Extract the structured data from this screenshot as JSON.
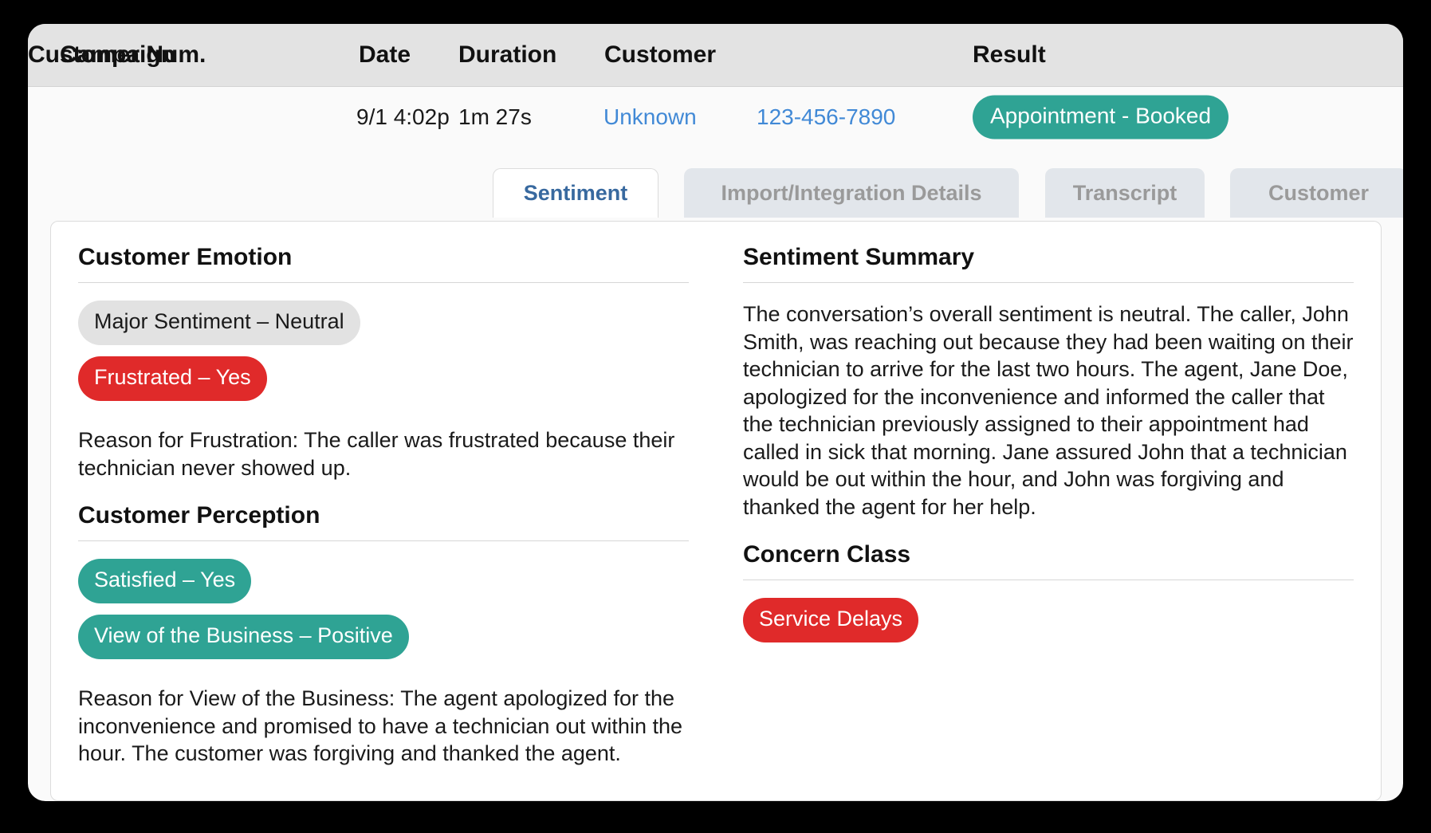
{
  "table": {
    "columns": [
      "Campaign",
      "Date",
      "Duration",
      "Customer",
      "Customer Num.",
      "Result"
    ],
    "row": {
      "campaign": "",
      "date": "9/1 4:02p",
      "duration": "1m 27s",
      "customer": "Unknown",
      "customer_number": "123-456-7890",
      "result": "Appointment - Booked"
    }
  },
  "tabs": [
    {
      "label": "Sentiment",
      "active": true
    },
    {
      "label": "Import/Integration Details",
      "active": false
    },
    {
      "label": "Transcript",
      "active": false
    },
    {
      "label": "Customer",
      "active": false
    }
  ],
  "sentiment": {
    "customer_emotion": {
      "heading": "Customer Emotion",
      "major_sentiment_badge": "Major Sentiment – Neutral",
      "frustrated_badge": "Frustrated – Yes",
      "reason": "Reason for Frustration: The caller was frustrated because their technician never showed up."
    },
    "customer_perception": {
      "heading": "Customer Perception",
      "satisfied_badge": "Satisfied – Yes",
      "view_badge": "View of the Business – Positive",
      "reason": "Reason for View of the Business: The agent apologized for the inconvenience and promised to have a technician out within the hour. The customer was forgiving and thanked the agent."
    },
    "summary": {
      "heading": "Sentiment Summary",
      "text": "The conversation’s overall sentiment is neutral. The caller, John Smith, was reaching out because they had been waiting on their technician to arrive for the last two hours. The agent, Jane Doe, apologized for the inconvenience and informed the caller that the technician previously assigned to their appointment had called in sick that morning. Jane assured John that a technician would be out within the hour, and John was forgiving and thanked the agent for her help."
    },
    "concern_class": {
      "heading": "Concern Class",
      "badge": "Service Delays"
    }
  },
  "colors": {
    "accent_teal": "#2fa394",
    "accent_red": "#e02a2a",
    "link_blue": "#4189d6",
    "active_tab_blue": "#38699f",
    "neutral_badge": "#e2e2e2",
    "header_bg": "#e3e3e3"
  }
}
